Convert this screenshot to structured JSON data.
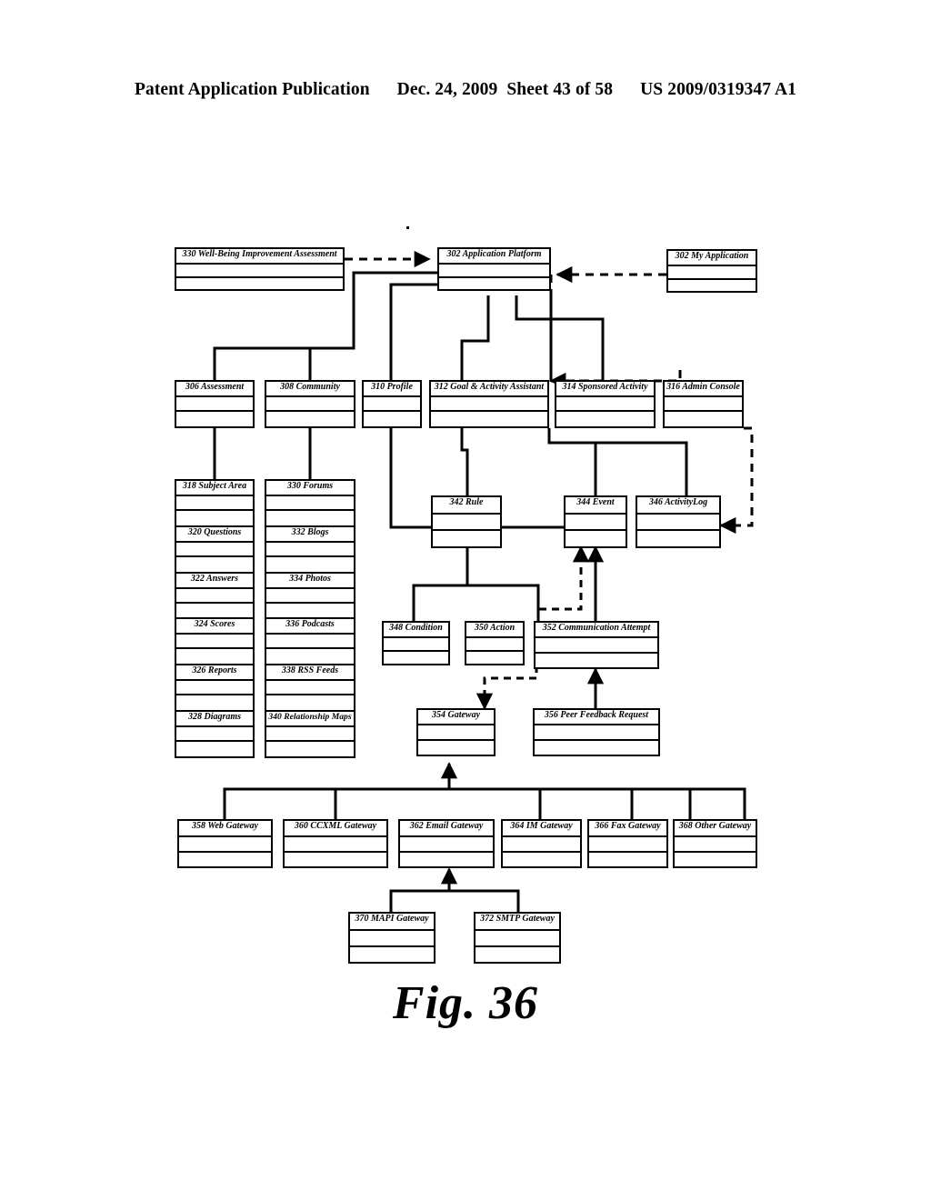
{
  "header": {
    "publication": "Patent Application Publication",
    "date": "Dec. 24, 2009",
    "sheet": "Sheet 43 of 58",
    "number": "US 2009/0319347 A1"
  },
  "caption": "Fig. 36",
  "figure": {
    "title": "Fig. 36",
    "nodes": [
      {
        "id": "330a",
        "label": "330 Well-Being Improvement Assessment"
      },
      {
        "id": "302",
        "label": "302 Application Platform"
      },
      {
        "id": "302b",
        "label": "302 My Application"
      },
      {
        "id": "306",
        "label": "306 Assessment"
      },
      {
        "id": "308",
        "label": "308 Community"
      },
      {
        "id": "310",
        "label": "310 Profile"
      },
      {
        "id": "312",
        "label": "312 Goal & Activity Assistant"
      },
      {
        "id": "314",
        "label": "314 Sponsored Activity"
      },
      {
        "id": "316",
        "label": "316 Admin Console"
      },
      {
        "id": "318",
        "label": "318 Subject Area"
      },
      {
        "id": "320",
        "label": "320 Questions"
      },
      {
        "id": "322",
        "label": "322 Answers"
      },
      {
        "id": "324",
        "label": "324 Scores"
      },
      {
        "id": "326",
        "label": "326 Reports"
      },
      {
        "id": "328",
        "label": "328 Diagrams"
      },
      {
        "id": "330",
        "label": "330 Forums"
      },
      {
        "id": "332",
        "label": "332 Blogs"
      },
      {
        "id": "334",
        "label": "334 Photos"
      },
      {
        "id": "336",
        "label": "336 Podcasts"
      },
      {
        "id": "338",
        "label": "338 RSS Feeds"
      },
      {
        "id": "340",
        "label": "340 Relationship Maps"
      },
      {
        "id": "342",
        "label": "342 Rule"
      },
      {
        "id": "344",
        "label": "344 Event"
      },
      {
        "id": "346",
        "label": "346 ActivityLog"
      },
      {
        "id": "348",
        "label": "348 Condition"
      },
      {
        "id": "350",
        "label": "350 Action"
      },
      {
        "id": "352",
        "label": "352 Communication Attempt"
      },
      {
        "id": "354",
        "label": "354 Gateway"
      },
      {
        "id": "356",
        "label": "356 Peer Feedback Request"
      },
      {
        "id": "358",
        "label": "358 Web Gateway"
      },
      {
        "id": "360",
        "label": "360 CCXML Gateway"
      },
      {
        "id": "362",
        "label": "362 Email Gateway"
      },
      {
        "id": "364",
        "label": "364 IM Gateway"
      },
      {
        "id": "366",
        "label": "366 Fax Gateway"
      },
      {
        "id": "368",
        "label": "368 Other Gateway"
      },
      {
        "id": "370",
        "label": "370 MAPI Gateway"
      },
      {
        "id": "372",
        "label": "372 SMTP Gateway"
      }
    ],
    "line_color": "#000000"
  }
}
